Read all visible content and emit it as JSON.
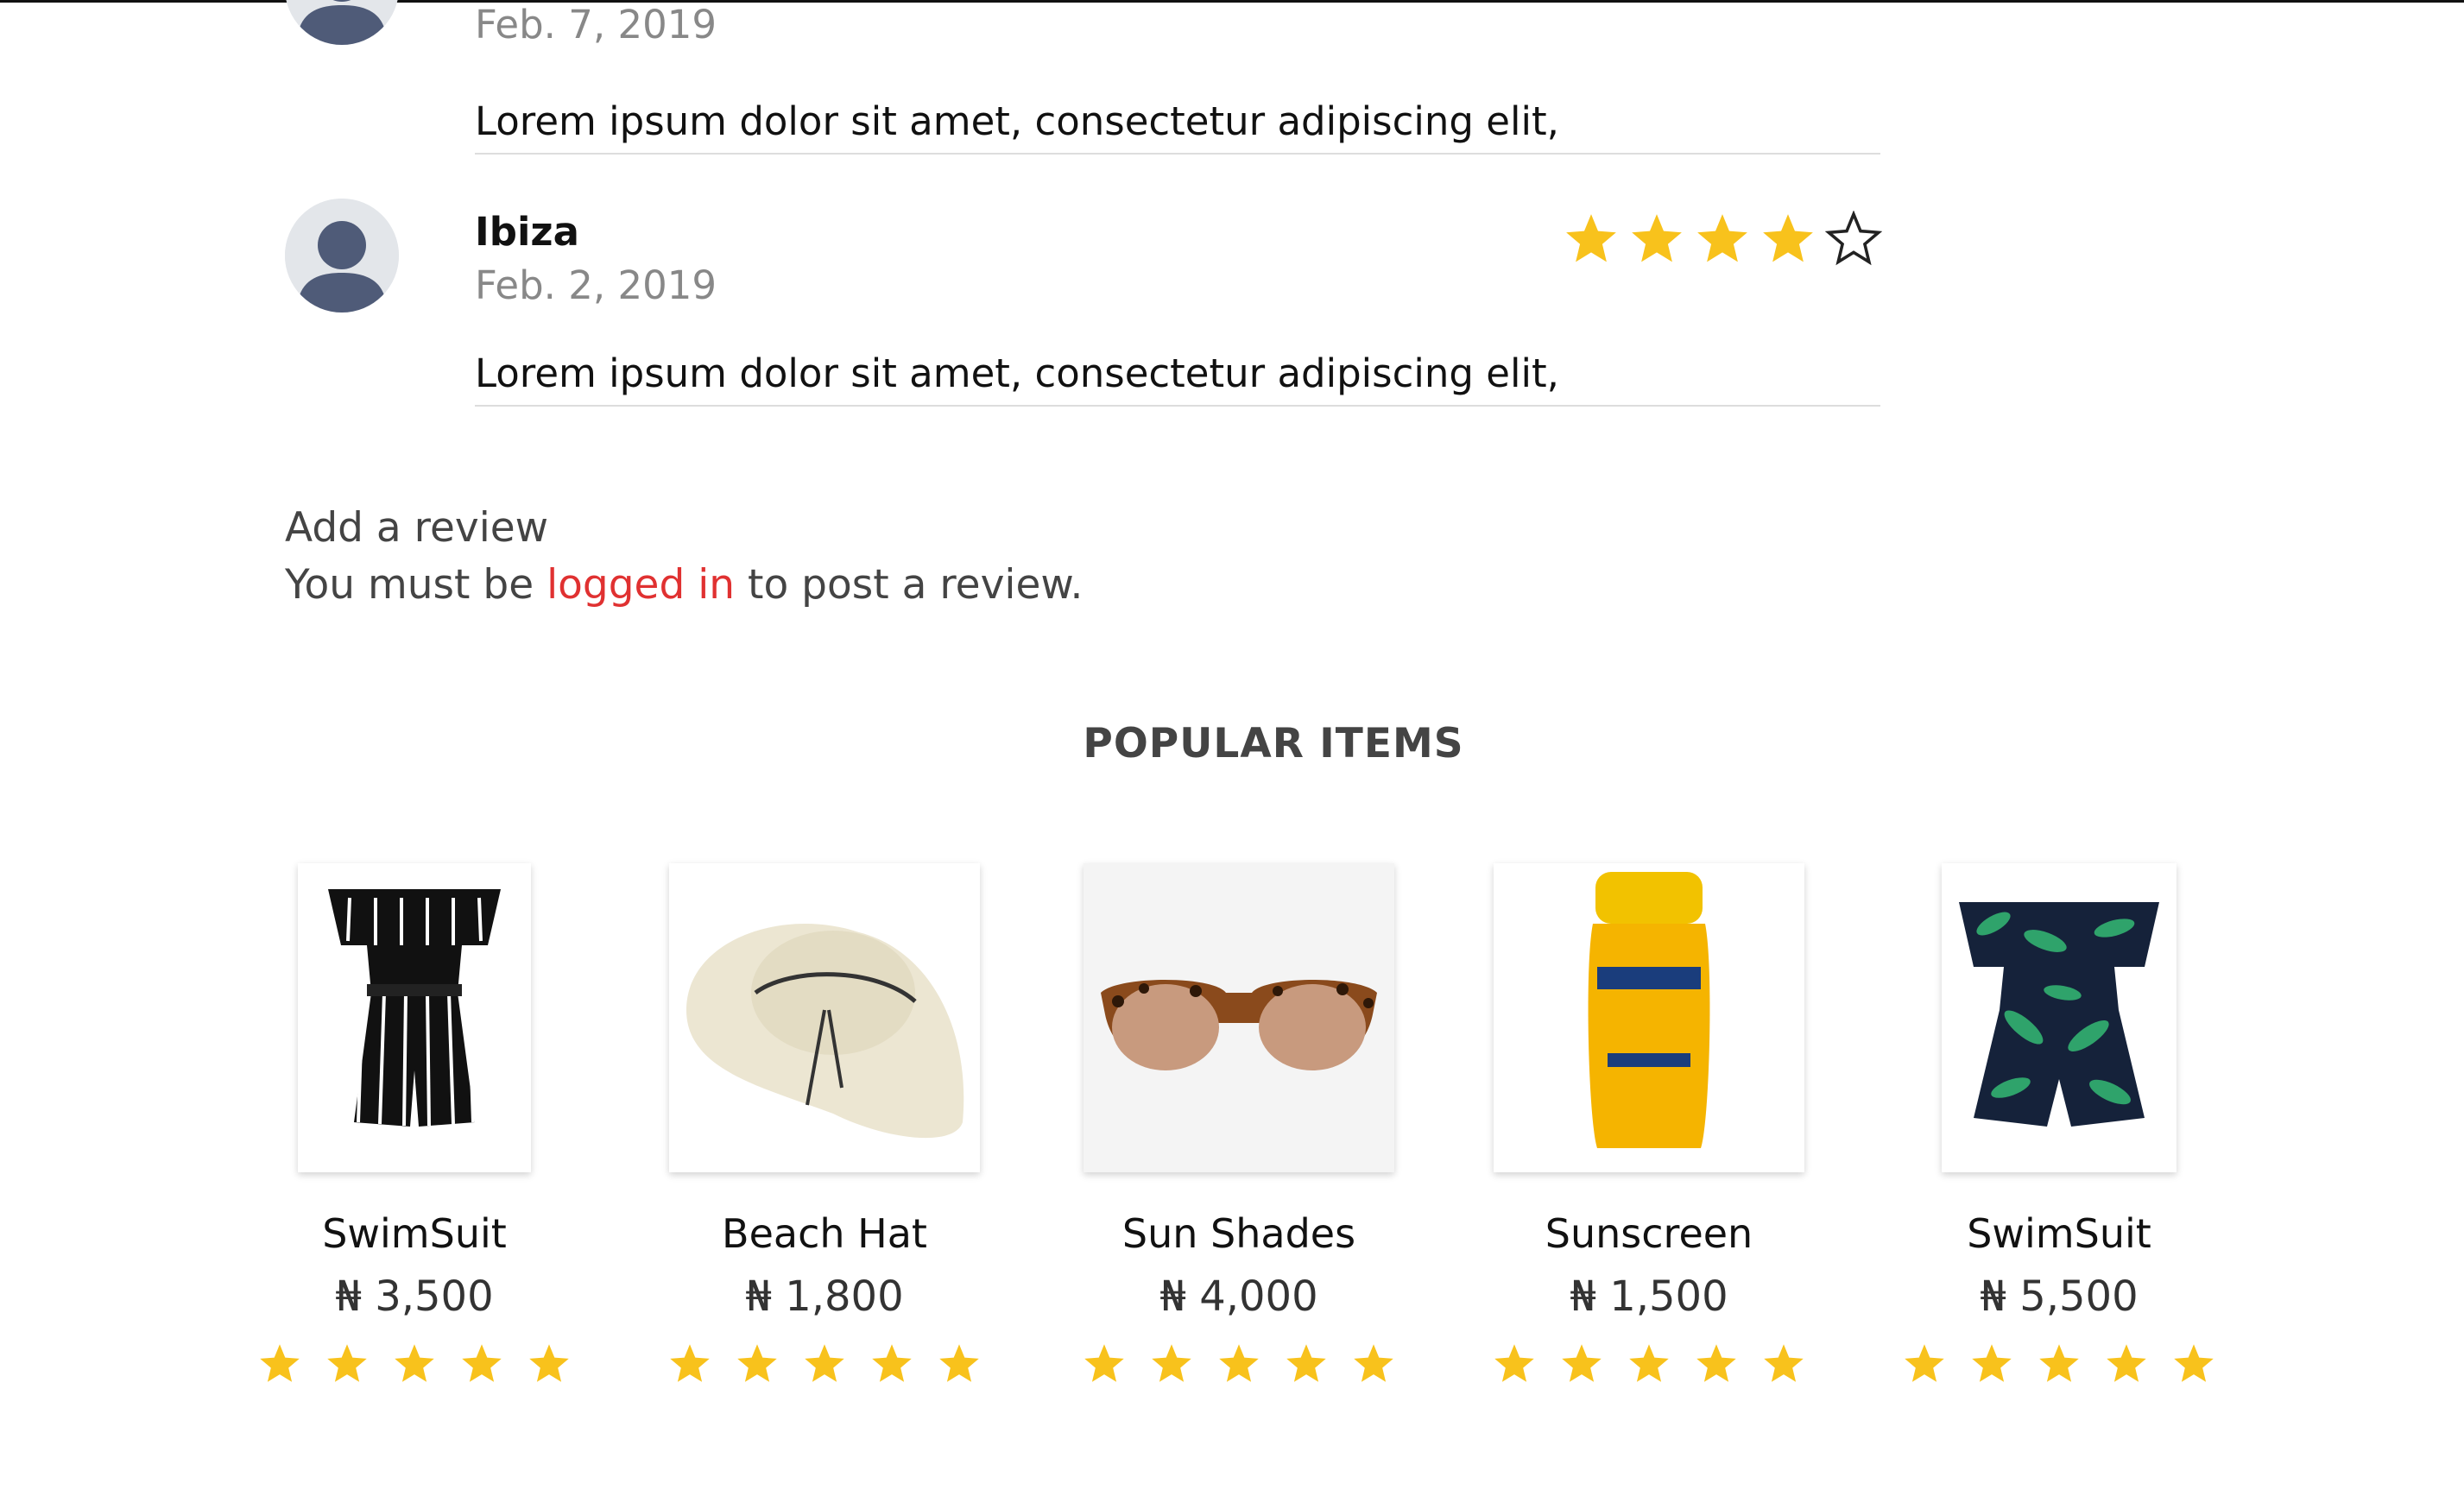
{
  "reviews": [
    {
      "name": "",
      "date": "Feb. 7, 2019",
      "text": "Lorem ipsum dolor sit amet, consectetur adipiscing elit,",
      "rating": null
    },
    {
      "name": "Ibiza",
      "date": "Feb. 2, 2019",
      "text": "Lorem ipsum dolor sit amet, consectetur adipiscing elit,",
      "rating": 4,
      "rating_max": 5
    }
  ],
  "add_review": {
    "title": "Add a review",
    "prefix": "You must be ",
    "link": "logged in",
    "suffix": " to post a review."
  },
  "popular": {
    "title": "POPULAR ITEMS",
    "items": [
      {
        "name": "SwimSuit",
        "price": "₦ 3,500",
        "rating": 5,
        "image_icon": "striped-romper-icon"
      },
      {
        "name": "Beach Hat",
        "price": "₦ 1,800",
        "rating": 5,
        "image_icon": "sun-hat-icon"
      },
      {
        "name": "Sun Shades",
        "price": "₦ 4,000",
        "rating": 5,
        "image_icon": "sunglasses-icon"
      },
      {
        "name": "Sunscreen",
        "price": "₦ 1,500",
        "rating": 5,
        "image_icon": "sunscreen-bottle-icon"
      },
      {
        "name": "SwimSuit",
        "price": "₦ 5,500",
        "rating": 5,
        "image_icon": "leaf-romper-icon"
      }
    ]
  },
  "colors": {
    "star": "#f8c21c",
    "link": "#e03131",
    "avatar": "#4f5b78"
  }
}
